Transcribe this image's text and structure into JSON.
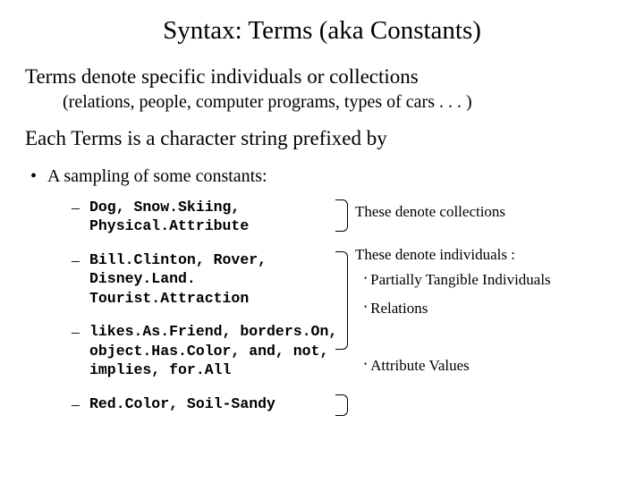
{
  "title": "Syntax: Terms (aka Constants)",
  "para1": "Terms denote specific individuals or collections",
  "sub1": "(relations, people, computer programs, types of cars . . . )",
  "para2": "Each Terms is a character string prefixed by",
  "bullet1": "A sampling of some constants:",
  "items": [
    "Dog, Snow.Skiing, Physical.Attribute",
    "Bill.Clinton, Rover, Disney.Land. Tourist.Attraction",
    "likes.As.Friend, borders.On, object.Has.Color, and, not, implies, for.All",
    "Red.Color, Soil-Sandy"
  ],
  "right": {
    "r1": "These denote collections",
    "r2": "These denote individuals :",
    "r2a": "Partially Tangible Individuals",
    "r2b": "Relations",
    "r3": "Attribute Values"
  }
}
